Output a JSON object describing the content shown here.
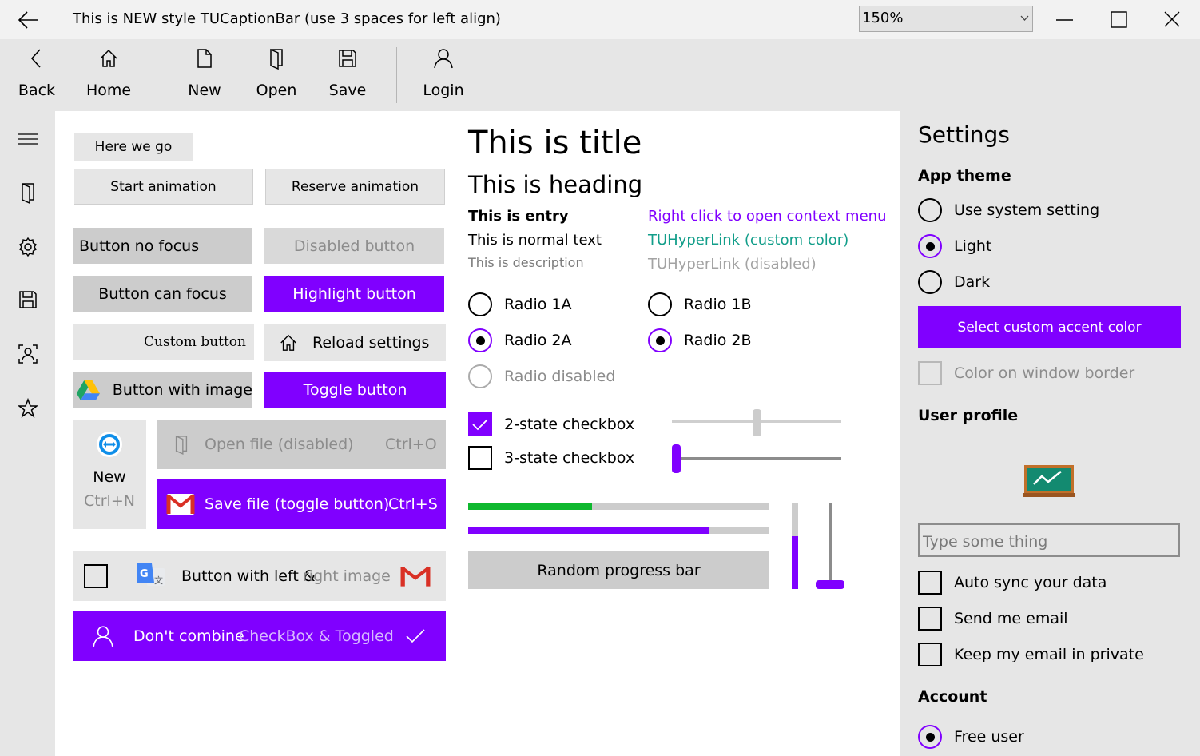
{
  "window": {
    "title": "This is NEW style TUCaptionBar (use 3 spaces for left align)",
    "zoom_value": "150%"
  },
  "toolbar": {
    "back": "Back",
    "home": "Home",
    "new": "New",
    "open": "Open",
    "save": "Save",
    "login": "Login"
  },
  "buttons": {
    "here_we_go": "Here we go",
    "start_animation": "Start animation",
    "reserve_animation": "Reserve animation",
    "no_focus": "Button no focus",
    "disabled": "Disabled button",
    "can_focus": "Button can focus",
    "highlight": "Highlight button",
    "custom": "Custom button",
    "reload": "Reload settings",
    "with_image": "Button with image",
    "toggle": "Toggle button",
    "new_label": "New",
    "new_shortcut": "Ctrl+N",
    "open_file": "Open file (disabled)",
    "open_shortcut": "Ctrl+O",
    "save_file": "Save file (toggle button)",
    "save_shortcut": "Ctrl+S",
    "left_right_a": "Button with left &",
    "left_right_b": "right image",
    "combine_a": "Don't combine",
    "combine_b": "CheckBox & Toggled",
    "random_progress": "Random progress bar"
  },
  "content": {
    "title": "This is title",
    "heading": "This is heading",
    "entry": "This is entry",
    "normal": "This is normal text",
    "description": "This is description",
    "link_context": "Right click to open context menu",
    "link_custom": "TUHyperLink (custom color)",
    "link_disabled": "TUHyperLink (disabled)",
    "radio_1a": "Radio 1A",
    "radio_1b": "Radio 1B",
    "radio_2a": "Radio 2A",
    "radio_2b": "Radio 2B",
    "radio_disabled": "Radio disabled",
    "check_2state": "2-state checkbox",
    "check_3state": "3-state checkbox",
    "progress_green": 0.41,
    "progress_purple": 0.8,
    "progress_vertical": 0.62,
    "slider_top": 0.5,
    "slider_bottom": 0.0,
    "slider_vertical": 0.0
  },
  "settings": {
    "title": "Settings",
    "app_theme": "App theme",
    "use_system": "Use system setting",
    "light": "Light",
    "dark": "Dark",
    "accent_button": "Select custom accent color",
    "color_border": "Color on window border",
    "user_profile": "User profile",
    "input_placeholder": "Type some thing",
    "auto_sync": "Auto sync your data",
    "send_email": "Send me email",
    "keep_private": "Keep my email in private",
    "account": "Account",
    "free_user": "Free user"
  },
  "colors": {
    "accent": "#8000ff",
    "green": "#0fb82f",
    "link_custom": "#129e8a"
  }
}
